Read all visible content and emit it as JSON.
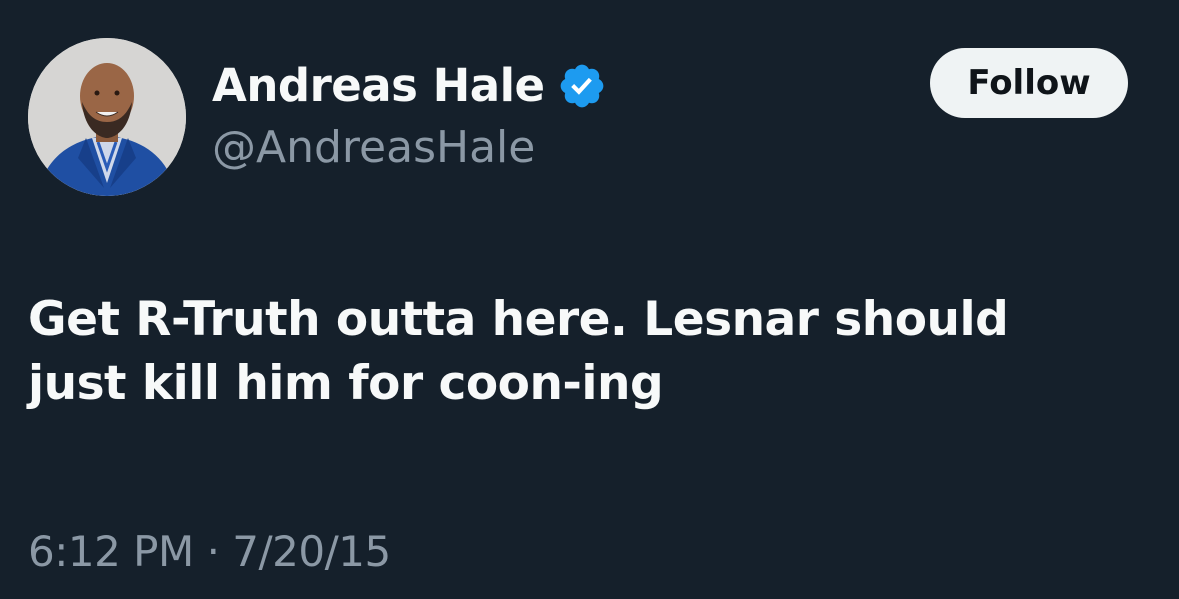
{
  "author": {
    "display_name": "Andreas Hale",
    "handle": "@AndreasHale",
    "verified_icon": "verified-badge-icon",
    "avatar_icon": "profile-avatar"
  },
  "actions": {
    "follow_label": "Follow"
  },
  "tweet": {
    "text_line1": "Get R-Truth outta here. Lesnar should",
    "text_line2": "just kill him for coon-ing",
    "timestamp": "6:12 PM · 7/20/15"
  },
  "colors": {
    "background": "#15202b",
    "primary_text": "#f7f9f9",
    "secondary_text": "#8b98a5",
    "verified_blue": "#1d9bf0",
    "button_bg": "#eff3f4",
    "button_text": "#0f1419"
  }
}
